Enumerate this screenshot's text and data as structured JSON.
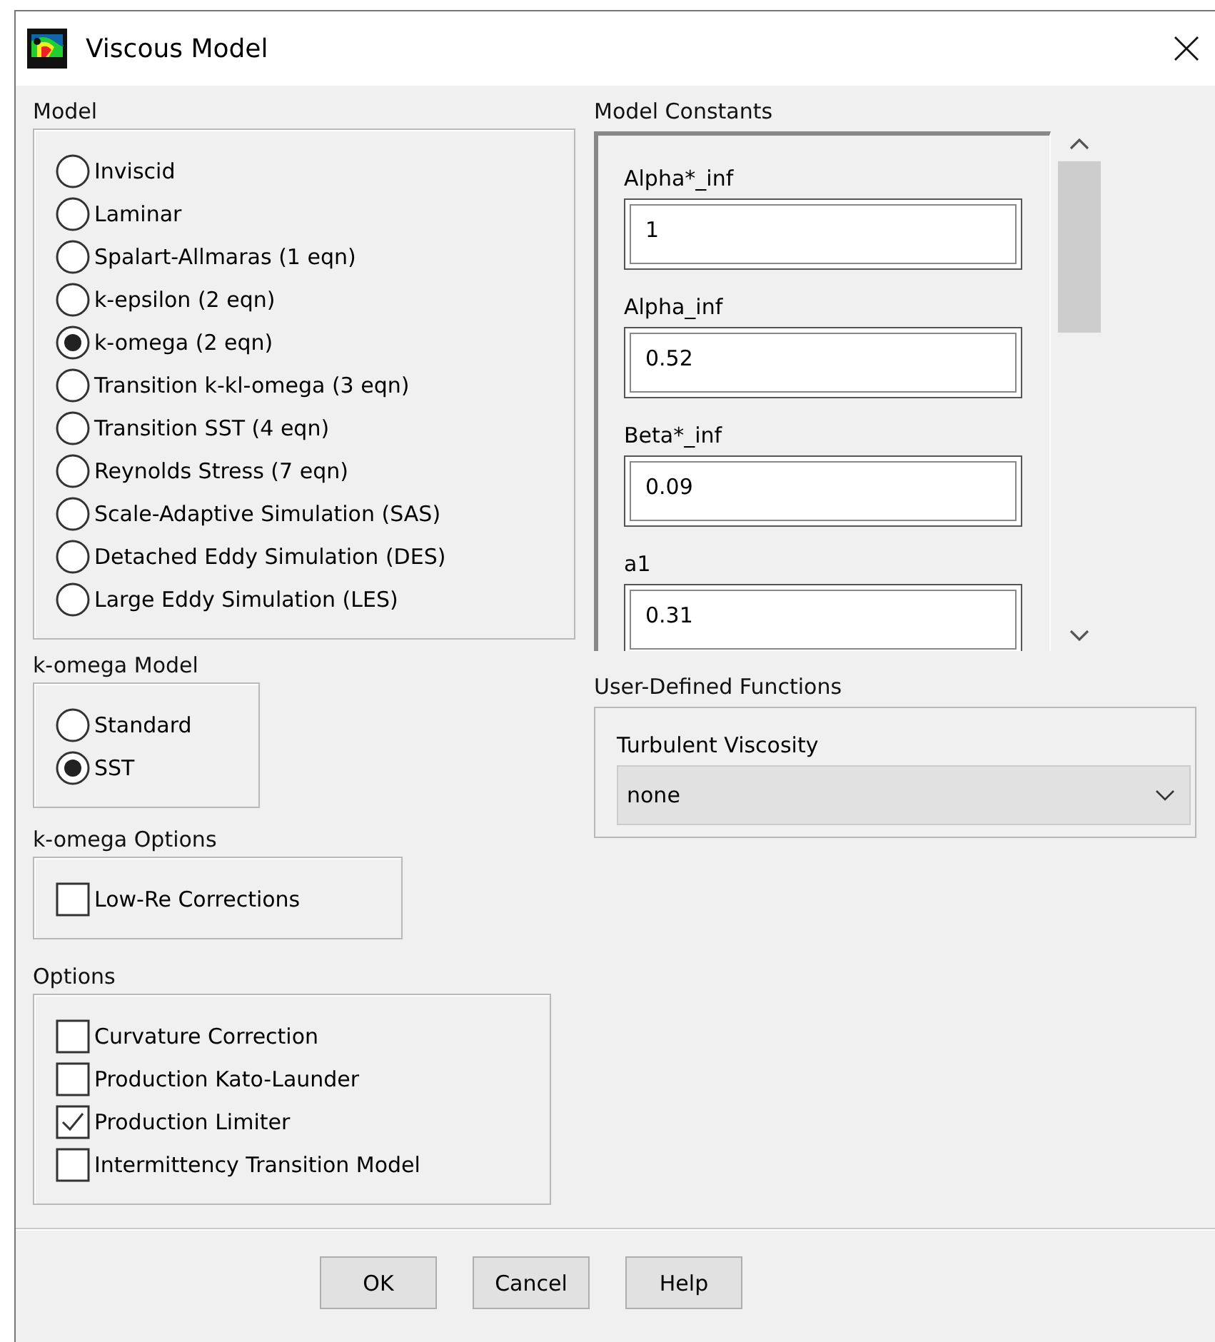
{
  "window": {
    "title": "Viscous Model"
  },
  "model": {
    "label": "Model",
    "options": [
      {
        "label": "Inviscid",
        "selected": false
      },
      {
        "label": "Laminar",
        "selected": false
      },
      {
        "label": "Spalart-Allmaras (1 eqn)",
        "selected": false
      },
      {
        "label": "k-epsilon (2 eqn)",
        "selected": false
      },
      {
        "label": "k-omega (2 eqn)",
        "selected": true
      },
      {
        "label": "Transition k-kl-omega (3 eqn)",
        "selected": false
      },
      {
        "label": "Transition SST (4 eqn)",
        "selected": false
      },
      {
        "label": "Reynolds Stress (7 eqn)",
        "selected": false
      },
      {
        "label": "Scale-Adaptive Simulation (SAS)",
        "selected": false
      },
      {
        "label": "Detached Eddy Simulation (DES)",
        "selected": false
      },
      {
        "label": "Large Eddy Simulation (LES)",
        "selected": false
      }
    ]
  },
  "k_omega_model": {
    "label": "k-omega Model",
    "options": [
      {
        "label": "Standard",
        "selected": false
      },
      {
        "label": "SST",
        "selected": true
      }
    ]
  },
  "k_omega_options": {
    "label": "k-omega Options",
    "options": [
      {
        "label": "Low-Re Corrections",
        "checked": false
      }
    ]
  },
  "options": {
    "label": "Options",
    "options": [
      {
        "label": "Curvature Correction",
        "checked": false
      },
      {
        "label": "Production Kato-Launder",
        "checked": false
      },
      {
        "label": "Production Limiter",
        "checked": true
      },
      {
        "label": "Intermittency Transition Model",
        "checked": false
      }
    ]
  },
  "model_constants": {
    "label": "Model Constants",
    "fields": [
      {
        "label": "Alpha*_inf",
        "value": "1"
      },
      {
        "label": "Alpha_inf",
        "value": "0.52"
      },
      {
        "label": "Beta*_inf",
        "value": "0.09"
      },
      {
        "label": "a1",
        "value": "0.31"
      }
    ]
  },
  "user_defined_functions": {
    "label": "User-Defined Functions",
    "fields": [
      {
        "label": "Turbulent Viscosity",
        "value": "none"
      }
    ]
  },
  "buttons": [
    "OK",
    "Cancel",
    "Help"
  ]
}
